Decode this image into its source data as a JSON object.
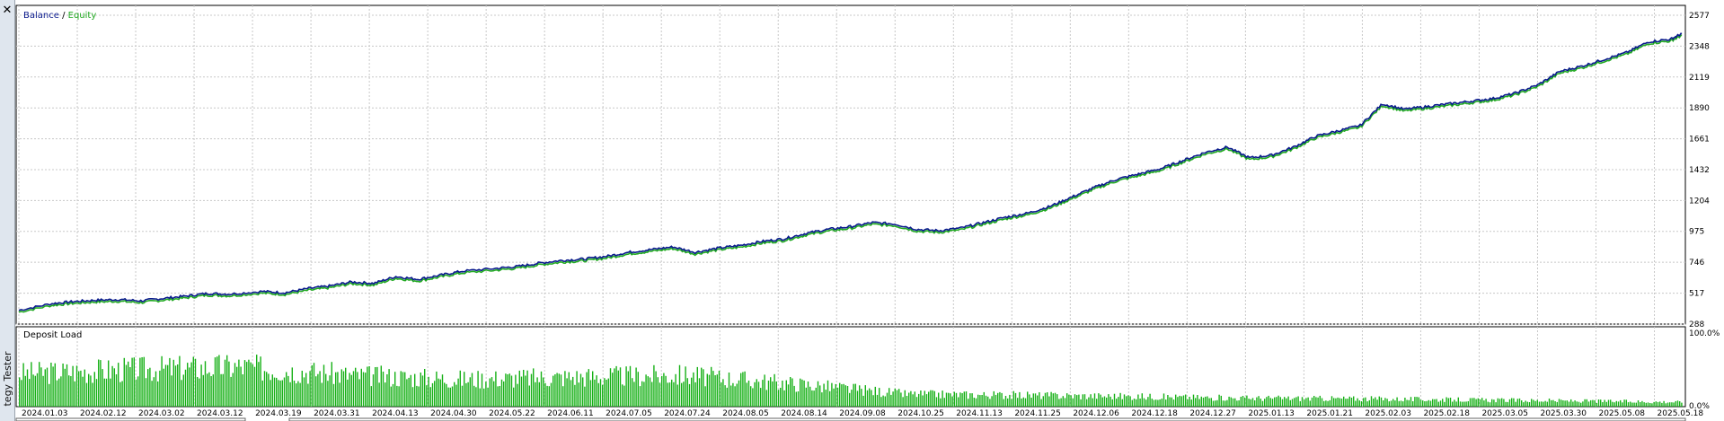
{
  "window": {
    "close_glyph": "✕",
    "side_label": "tegy Tester"
  },
  "top_panel": {
    "legend_balance": "Balance",
    "legend_sep": " / ",
    "legend_equity": "Equity",
    "colors": {
      "balance": "#0a1a8c",
      "equity": "#22aa22",
      "grid": "#c8c8c8"
    }
  },
  "bottom_panel": {
    "title": "Deposit Load",
    "max_label": "100.0%",
    "min_label": "0.0%",
    "bar_color": "#16b016"
  },
  "chart_data": [
    {
      "type": "line",
      "title": "",
      "series": [
        {
          "name": "Balance",
          "color": "#0a1a8c"
        },
        {
          "name": "Equity",
          "color": "#22aa22"
        }
      ],
      "y_ticks": [
        "2577",
        "2348",
        "2119",
        "1890",
        "1661",
        "1432",
        "1204",
        "975",
        "746",
        "517",
        "288"
      ],
      "ylim": [
        288,
        2650
      ],
      "x_ticks": [
        "2024.01.03",
        "2024.02.12",
        "2024.03.02",
        "2024.03.12",
        "2024.03.19",
        "2024.03.31",
        "2024.04.13",
        "2024.04.30",
        "2024.05.22",
        "2024.06.11",
        "2024.07.05",
        "2024.07.24",
        "2024.08.05",
        "2024.08.14",
        "2024.09.08",
        "2024.10.25",
        "2024.11.13",
        "2024.11.25",
        "2024.12.06",
        "2024.12.18",
        "2024.12.27",
        "2025.01.13",
        "2025.01.21",
        "2025.02.03",
        "2025.02.18",
        "2025.03.05",
        "2025.03.30",
        "2025.05.08",
        "2025.05.18"
      ],
      "x": [
        0,
        3,
        5,
        7,
        9,
        11,
        13,
        15,
        17,
        19,
        22,
        24,
        26,
        28,
        30,
        32,
        34,
        36,
        38,
        40,
        43,
        45,
        47,
        49,
        51,
        53,
        55,
        57,
        59,
        61,
        63,
        65,
        67,
        69,
        71,
        73,
        75,
        77,
        79,
        81,
        83,
        85,
        87,
        89,
        91,
        93,
        95,
        97,
        99,
        101,
        103,
        105,
        107,
        109,
        111,
        113,
        115,
        117,
        119,
        121,
        123,
        125,
        127,
        129,
        131,
        133,
        135,
        137,
        139,
        141,
        143,
        145,
        147,
        149,
        150
      ],
      "y": [
        390,
        440,
        455,
        465,
        470,
        460,
        478,
        495,
        515,
        510,
        530,
        520,
        550,
        570,
        600,
        590,
        640,
        620,
        650,
        680,
        700,
        715,
        740,
        760,
        770,
        790,
        820,
        840,
        860,
        820,
        850,
        870,
        900,
        920,
        960,
        990,
        1010,
        1040,
        1030,
        990,
        980,
        1000,
        1040,
        1080,
        1110,
        1160,
        1230,
        1300,
        1360,
        1400,
        1440,
        1500,
        1560,
        1600,
        1520,
        1540,
        1600,
        1680,
        1720,
        1760,
        1920,
        1880,
        1900,
        1920,
        1940,
        1960,
        2000,
        2060,
        2160,
        2200,
        2250,
        2300,
        2380,
        2400,
        2440
      ]
    },
    {
      "type": "bar",
      "title": "Deposit Load",
      "ylim": [
        0,
        100
      ],
      "profile_x": [
        0,
        10,
        20,
        30,
        40,
        50,
        60,
        70,
        80,
        90,
        100,
        110,
        120,
        130,
        140,
        150
      ],
      "profile_y": [
        58,
        65,
        70,
        55,
        48,
        52,
        55,
        40,
        22,
        20,
        18,
        15,
        14,
        12,
        10,
        8
      ]
    }
  ]
}
